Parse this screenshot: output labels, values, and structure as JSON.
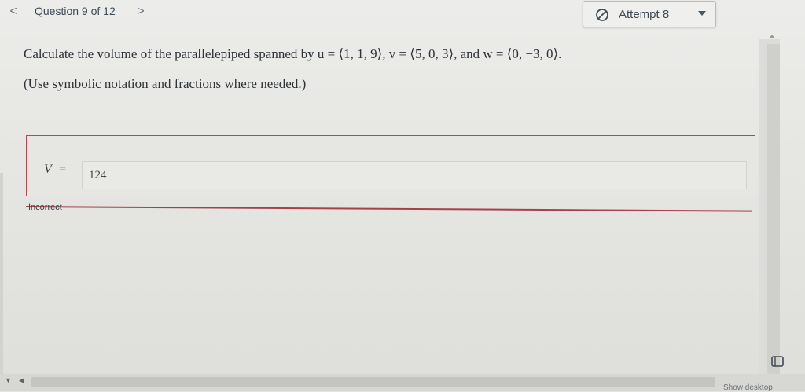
{
  "nav": {
    "prev_glyph": "<",
    "question_label": "Question 9 of 12",
    "next_glyph": ">"
  },
  "attempt": {
    "label": "Attempt 8",
    "icon": "no-entry-icon",
    "caret_icon": "caret-down-icon"
  },
  "question": {
    "text": "Calculate the volume of the parallelepiped spanned by u = ⟨1, 1, 9⟩, v = ⟨5, 0, 3⟩, and w = ⟨0, −3, 0⟩.",
    "hint": "(Use symbolic notation and fractions where needed.)"
  },
  "answer": {
    "variable": "V",
    "equals": "=",
    "value": "124",
    "status": "Incorrect",
    "status_color": "#a8404c"
  },
  "footer": {
    "show_desktop": "Show desktop"
  }
}
